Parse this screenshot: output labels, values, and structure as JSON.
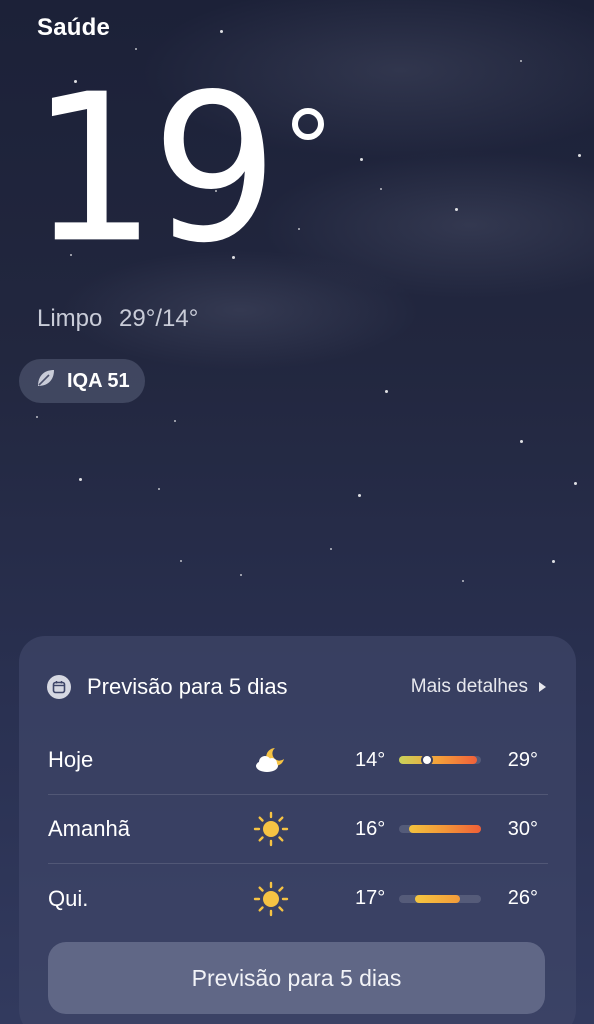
{
  "location": "Saúde",
  "current": {
    "temperature": "19",
    "condition": "Limpo",
    "high_low": "29°/14°"
  },
  "aqi": {
    "label": "IQA 51",
    "icon": "leaf-icon"
  },
  "forecast": {
    "title": "Previsão para 5 dias",
    "more_label": "Mais detalhes",
    "button_label": "Previsão para 5 dias",
    "days": [
      {
        "day": "Hoje",
        "icon": "night-cloud-moon-icon",
        "low": "14°",
        "high": "29°",
        "range_start": 0.0,
        "range_end": 0.95,
        "current_marker": 0.34,
        "gradient": [
          "#c9d35a",
          "#f5a13a",
          "#f0603a"
        ]
      },
      {
        "day": "Amanhã",
        "icon": "sun-icon",
        "low": "16°",
        "high": "30°",
        "range_start": 0.12,
        "range_end": 1.0,
        "gradient": [
          "#f2c33e",
          "#f39638",
          "#ef5f37"
        ]
      },
      {
        "day": "Qui.",
        "icon": "sun-icon",
        "low": "17°",
        "high": "26°",
        "range_start": 0.2,
        "range_end": 0.75,
        "gradient": [
          "#f4c640",
          "#f39b3a"
        ]
      }
    ]
  },
  "colors": {
    "background_top": "#1c2138",
    "background_bottom": "#323a5e",
    "card": "#3e4568",
    "sun": "#f6c343"
  }
}
